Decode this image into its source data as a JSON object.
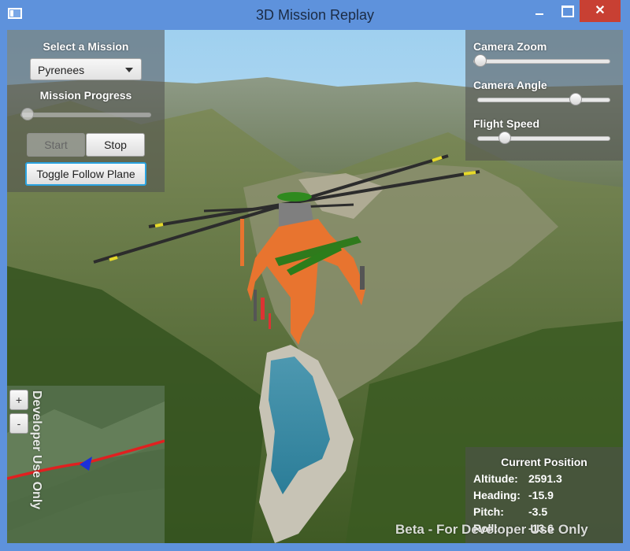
{
  "window": {
    "title": "3D Mission Replay"
  },
  "mission_panel": {
    "select_label": "Select a Mission",
    "selected_mission": "Pyrenees",
    "progress_label": "Mission Progress",
    "progress_value": 0.0,
    "start_label": "Start",
    "stop_label": "Stop",
    "toggle_follow_label": "Toggle Follow Plane"
  },
  "camera_panel": {
    "zoom_label": "Camera Zoom",
    "zoom_value": 0.0,
    "angle_label": "Camera Angle",
    "angle_value": 0.77,
    "speed_label": "Flight Speed",
    "speed_value": 0.17
  },
  "position_panel": {
    "title": "Current Position",
    "rows": [
      {
        "label": "Altitude:",
        "value": "2591.3"
      },
      {
        "label": "Heading:",
        "value": "-15.9"
      },
      {
        "label": "Pitch:",
        "value": "-3.5"
      },
      {
        "label": "Roll:",
        "value": "-13.6"
      }
    ]
  },
  "overview_map": {
    "zoom_in": "+",
    "zoom_out": "-",
    "watermark": "Developer Use Only"
  },
  "scene": {
    "watermark": "Beta - For Developer Use Only",
    "aircraft": "helicopter-model"
  },
  "colors": {
    "titlebar": "#5e92dc",
    "close": "#c84033",
    "focus": "#2aa3e0",
    "helicopter_body": "#e8742f",
    "rotor_tips": "#e6d92a",
    "track": "#e02020",
    "plane_marker": "#1a2fd8"
  }
}
